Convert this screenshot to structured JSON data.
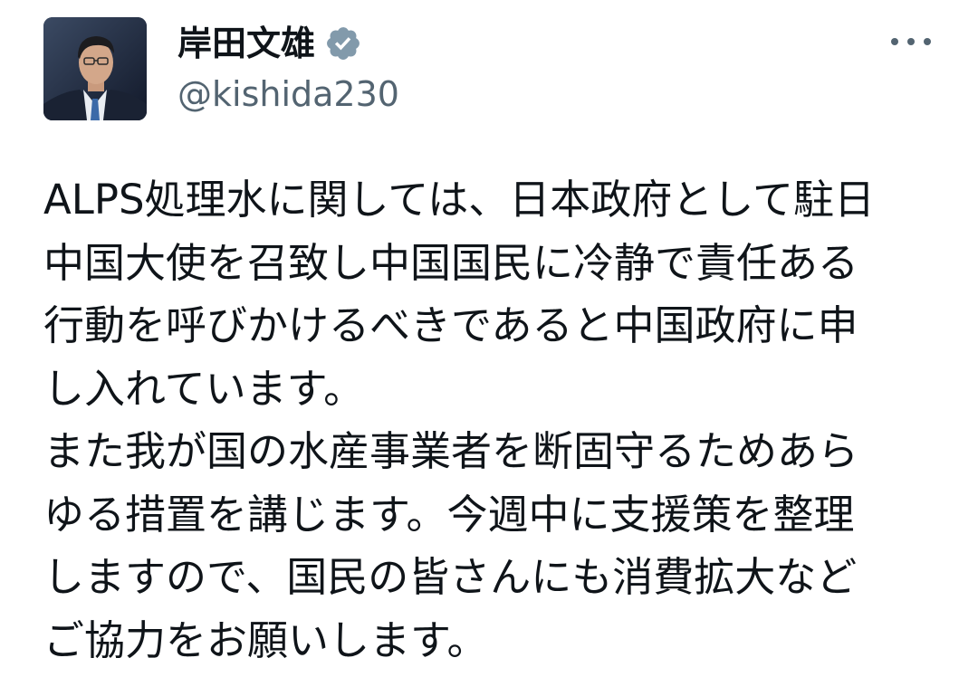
{
  "tweet": {
    "author": {
      "display_name": "岸田文雄",
      "handle": "@kishida230",
      "verified": true,
      "verified_badge_color": "#829aab"
    },
    "more_icon": "more-horizontal-icon",
    "text_lines": [
      "ALPS処理水に関しては、日本政府として駐日",
      "中国大使を召致し中国国民に冷静で責任ある",
      "行動を呼びかけるべきであると中国政府に申",
      "し入れています。",
      "また我が国の水産事業者を断固守るためあら",
      "ゆる措置を講じます。今週中に支援策を整理",
      "しますので、国民の皆さんにも消費拡大など",
      "ご協力をお願いします。"
    ]
  }
}
